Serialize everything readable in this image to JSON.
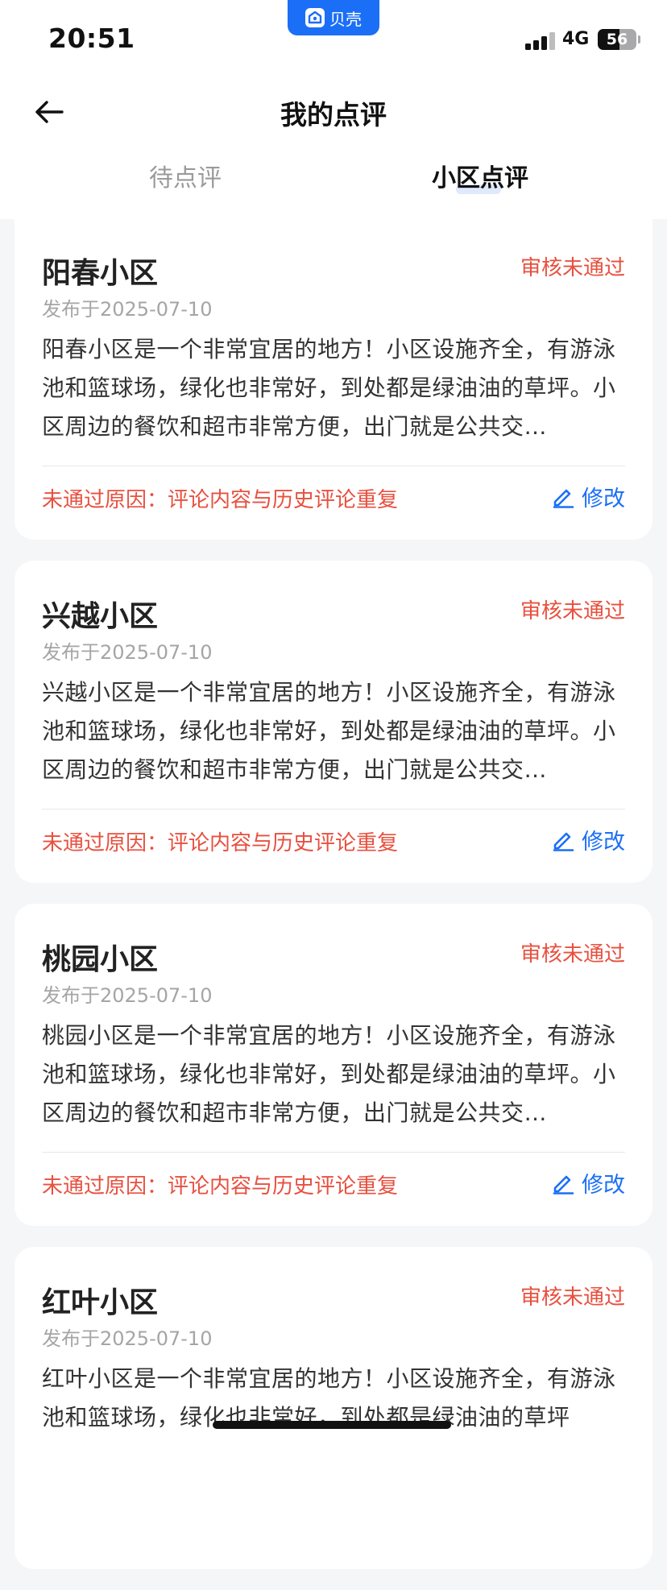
{
  "status_bar": {
    "time": "20:51",
    "app_badge": "贝壳",
    "network": "4G",
    "battery": "56",
    "battery_level_percent": 56
  },
  "header": {
    "title": "我的点评",
    "tabs": [
      {
        "label": "待点评",
        "active": false
      },
      {
        "label": "小区点评",
        "active": true
      }
    ]
  },
  "reviews": [
    {
      "name": "阳春小区",
      "status": "审核未通过",
      "date": "发布于2025-07-10",
      "content": "阳春小区是一个非常宜居的地方！小区设施齐全，有游泳池和篮球场，绿化也非常好，到处都是绿油油的草坪。小区周边的餐饮和超市非常方便，出门就是公共交…",
      "reason": "未通过原因：评论内容与历史评论重复",
      "edit_label": "修改"
    },
    {
      "name": "兴越小区",
      "status": "审核未通过",
      "date": "发布于2025-07-10",
      "content": "兴越小区是一个非常宜居的地方！小区设施齐全，有游泳池和篮球场，绿化也非常好，到处都是绿油油的草坪。小区周边的餐饮和超市非常方便，出门就是公共交…",
      "reason": "未通过原因：评论内容与历史评论重复",
      "edit_label": "修改"
    },
    {
      "name": "桃园小区",
      "status": "审核未通过",
      "date": "发布于2025-07-10",
      "content": "桃园小区是一个非常宜居的地方！小区设施齐全，有游泳池和篮球场，绿化也非常好，到处都是绿油油的草坪。小区周边的餐饮和超市非常方便，出门就是公共交…",
      "reason": "未通过原因：评论内容与历史评论重复",
      "edit_label": "修改"
    },
    {
      "name": "红叶小区",
      "status": "审核未通过",
      "date": "发布于2025-07-10",
      "content": "红叶小区是一个非常宜居的地方！小区设施齐全，有游泳池和篮球场，绿化也非常好，到处都是绿油油的草坪",
      "reason": "",
      "edit_label": ""
    }
  ],
  "colors": {
    "accent_blue": "#1b6ff6",
    "status_red": "#e8503f",
    "background": "#f5f6f8"
  },
  "icons": {
    "back": "arrow-left-icon",
    "edit": "pencil-icon"
  }
}
